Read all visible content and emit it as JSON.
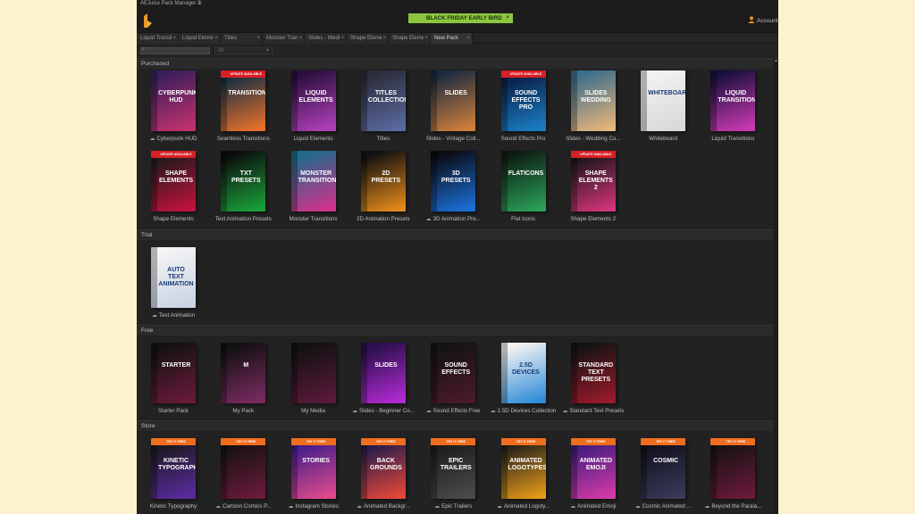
{
  "app": {
    "title": "AEJuice Pack Manager 3",
    "menu_glyph": "≡"
  },
  "promo": {
    "text": "BLACK FRIDAY EARLY BIRD",
    "close": "×"
  },
  "account": {
    "label": "Account"
  },
  "tabs": [
    {
      "label": "Liquid Transit",
      "close": "×"
    },
    {
      "label": "Liquid Elemer",
      "close": "×"
    },
    {
      "label": "Titles",
      "close": "×"
    },
    {
      "label": "Monster Tran",
      "close": "×"
    },
    {
      "label": "Slides - Wedi",
      "close": "×"
    },
    {
      "label": "Shape Eleme",
      "close": "×"
    },
    {
      "label": "Shape Eleme",
      "close": "×"
    },
    {
      "label": "New Pack",
      "close": "×"
    }
  ],
  "filter": {
    "search_placeholder": "",
    "category_value": "All"
  },
  "sections": [
    {
      "title": "Purchased"
    },
    {
      "title": "Trial"
    },
    {
      "title": "Free"
    },
    {
      "title": "Store"
    }
  ],
  "purchased": [
    {
      "label": "Cyberpunk HUD",
      "cloud": true,
      "box": "CYBERPUNK\nHUD",
      "ribbon": "",
      "colors": [
        "#3a1f5c",
        "#c2306e"
      ]
    },
    {
      "label": "Seamless Transitions",
      "cloud": false,
      "box": "TRANSITIONS",
      "ribbon": "UPDATE AVAILABLE",
      "colors": [
        "#0e2c44",
        "#e9702a"
      ]
    },
    {
      "label": "Liquid Elements",
      "cloud": false,
      "box": "LIQUID\nELEMENTS",
      "ribbon": "",
      "colors": [
        "#2a0f3e",
        "#b03fb8"
      ]
    },
    {
      "label": "Titles",
      "cloud": false,
      "box": "TITLES\nCOLLECTION",
      "ribbon": "",
      "colors": [
        "#2c2c3a",
        "#5a6aa0"
      ]
    },
    {
      "label": "Slides - Vintage Coll...",
      "cloud": false,
      "box": "SLIDES",
      "ribbon": "",
      "colors": [
        "#1b2a3e",
        "#d17f3c"
      ]
    },
    {
      "label": "Sound Effects Pro",
      "cloud": false,
      "box": "SOUND\nEFFECTS\nPRO",
      "ribbon": "UPDATE AVAILABLE",
      "colors": [
        "#0a1a40",
        "#1a7dc4"
      ]
    },
    {
      "label": "Slides - Wedding Co...",
      "cloud": false,
      "box": "SLIDES\nWEDDING",
      "ribbon": "",
      "colors": [
        "#3c6e8c",
        "#e7b47a"
      ]
    },
    {
      "label": "Whiteboard",
      "cloud": false,
      "box": "WHITEBOARD",
      "ribbon": "",
      "colors": [
        "#f2f2f2",
        "#d8d8d8"
      ]
    },
    {
      "label": "Liquid Transitions",
      "cloud": false,
      "box": "LIQUID\nTRANSITIONS",
      "ribbon": "",
      "colors": [
        "#1a0f3c",
        "#c93ab2"
      ]
    },
    {
      "label": "Shape Elements",
      "cloud": false,
      "box": "SHAPE\nELEMENTS",
      "ribbon": "UPDATE AVAILABLE",
      "colors": [
        "#1a1a1a",
        "#c2123c"
      ]
    },
    {
      "label": "Text Animation Presets",
      "cloud": false,
      "box": "TXT\nPRESETS",
      "ribbon": "",
      "colors": [
        "#0d0d0d",
        "#19a03a"
      ]
    },
    {
      "label": "Monster Transitions",
      "cloud": false,
      "box": "MONSTER\nTRANSITIONS",
      "ribbon": "",
      "colors": [
        "#1f6a8a",
        "#d4318c"
      ]
    },
    {
      "label": "2D Animation Presets",
      "cloud": false,
      "box": "2D\nPRESETS",
      "ribbon": "",
      "colors": [
        "#111111",
        "#e58a1a"
      ]
    },
    {
      "label": "3D Animation Pre...",
      "cloud": true,
      "box": "3D\nPRESETS",
      "ribbon": "",
      "colors": [
        "#0b0b14",
        "#1b6fd8"
      ]
    },
    {
      "label": "Flat Icons",
      "cloud": false,
      "box": "FLATICONS",
      "ribbon": "",
      "colors": [
        "#0e1c12",
        "#2aa058"
      ]
    },
    {
      "label": "Shape Elements 2",
      "cloud": false,
      "box": "SHAPE\nELEMENTS\n2",
      "ribbon": "UPDATE AVAILABLE",
      "colors": [
        "#141414",
        "#d3347a"
      ]
    }
  ],
  "trial": [
    {
      "label": "Text Animation",
      "cloud": true,
      "box": "AUTO\nTEXT\nANIMATION",
      "ribbon": "",
      "colors": [
        "#f4f4f4",
        "#c9d3e3"
      ]
    }
  ],
  "free": [
    {
      "label": "Starter Pack",
      "cloud": false,
      "box": "STARTER",
      "ribbon": "",
      "colors": [
        "#121212",
        "#6a1a3a"
      ]
    },
    {
      "label": "My Pack",
      "cloud": false,
      "box": "M",
      "ribbon": "",
      "colors": [
        "#111111",
        "#7a2a60"
      ]
    },
    {
      "label": "My Media",
      "cloud": false,
      "box": "",
      "ribbon": "",
      "colors": [
        "#111111",
        "#5a1a3a"
      ]
    },
    {
      "label": "Slides - Beginner Co...",
      "cloud": true,
      "box": "SLIDES",
      "ribbon": "",
      "colors": [
        "#2a0f4a",
        "#b12ad2"
      ]
    },
    {
      "label": "Sound Effects Free",
      "cloud": true,
      "box": "SOUND\nEFFECTS",
      "ribbon": "",
      "colors": [
        "#131313",
        "#4a1a2a"
      ]
    },
    {
      "label": "2.5D Devices Collection",
      "cloud": true,
      "box": "2.5D Devices",
      "ribbon": "",
      "colors": [
        "#f4f4f4",
        "#2d8ad8"
      ]
    },
    {
      "label": "Standard Text Presets",
      "cloud": true,
      "box": "STANDARD\nTEXT\nPRESETS",
      "ribbon": "",
      "colors": [
        "#131313",
        "#9a1a2a"
      ]
    }
  ],
  "store": [
    {
      "label": "Kinetic Typography",
      "cloud": false,
      "box": "KINETIC\nTYPOGRAPHY",
      "ribbon": "TRY IT FREE",
      "colors": [
        "#171717",
        "#5a2ca0"
      ]
    },
    {
      "label": "Cartoon Comics P...",
      "cloud": true,
      "box": "",
      "ribbon": "TRY IT FREE",
      "colors": [
        "#111111",
        "#6a1a3a"
      ]
    },
    {
      "label": "Instagram Stories",
      "cloud": true,
      "box": "STORIES",
      "ribbon": "TRY IT FREE",
      "colors": [
        "#3a1a8a",
        "#e04a8c"
      ]
    },
    {
      "label": "Animated Backgr...",
      "cloud": true,
      "box": "BACK\nGROUNDS",
      "ribbon": "TRY IT FREE",
      "colors": [
        "#1a1a4a",
        "#e6473a"
      ]
    },
    {
      "label": "Epic Trailers",
      "cloud": true,
      "box": "EPIC\nTRAILERS",
      "ribbon": "TRY IT FREE",
      "colors": [
        "#1a1a1a",
        "#4a4a4a"
      ]
    },
    {
      "label": "Animated Logoty...",
      "cloud": true,
      "box": "ANIMATED\nLOGOTYPES",
      "ribbon": "TRY IT FREE",
      "colors": [
        "#1a1a1a",
        "#e69a1a"
      ]
    },
    {
      "label": "Animated Emoji",
      "cloud": true,
      "box": "ANIMATED\nEMOJI",
      "ribbon": "TRY IT FREE",
      "colors": [
        "#3a1a7a",
        "#d43aa8"
      ]
    },
    {
      "label": "Cosmic Animated ...",
      "cloud": true,
      "box": "COSMIC",
      "ribbon": "TRY IT FREE",
      "colors": [
        "#0e0e1a",
        "#3a3a5a"
      ]
    },
    {
      "label": "Beyond the Parala...",
      "cloud": true,
      "box": "",
      "ribbon": "TRY IT FREE",
      "colors": [
        "#111111",
        "#6a1a3a"
      ]
    }
  ]
}
